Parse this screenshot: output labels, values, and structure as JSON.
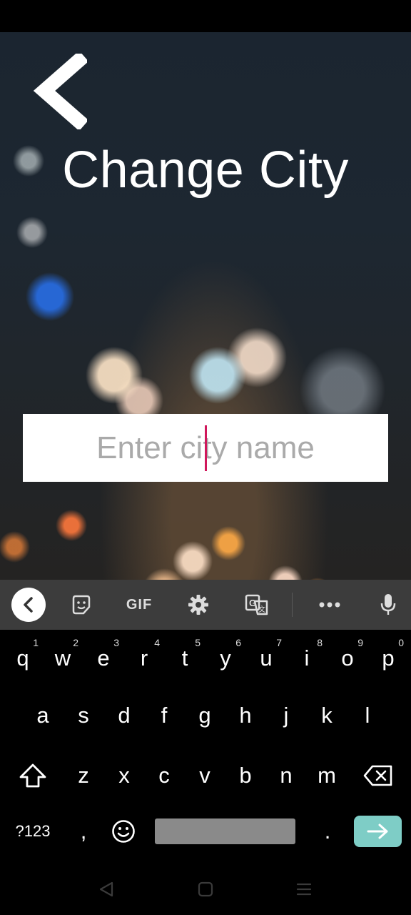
{
  "app": {
    "title": "Change City",
    "city_input": {
      "value": "",
      "placeholder": "Enter city name"
    }
  },
  "keyboard": {
    "toolbar": [
      "collapse-icon",
      "sticker-icon",
      "GIF",
      "gear-icon",
      "translate-icon",
      "more-icon",
      "mic-icon"
    ],
    "row1": [
      {
        "key": "q",
        "hint": "1"
      },
      {
        "key": "w",
        "hint": "2"
      },
      {
        "key": "e",
        "hint": "3"
      },
      {
        "key": "r",
        "hint": "4"
      },
      {
        "key": "t",
        "hint": "5"
      },
      {
        "key": "y",
        "hint": "6"
      },
      {
        "key": "u",
        "hint": "7"
      },
      {
        "key": "i",
        "hint": "8"
      },
      {
        "key": "o",
        "hint": "9"
      },
      {
        "key": "p",
        "hint": "0"
      }
    ],
    "row2": [
      "a",
      "s",
      "d",
      "f",
      "g",
      "h",
      "j",
      "k",
      "l"
    ],
    "row3": [
      "z",
      "x",
      "c",
      "v",
      "b",
      "n",
      "m"
    ],
    "symbols_label": "?123",
    "comma": ",",
    "period": ".",
    "accent_color": "#7ecdc6"
  },
  "navigation": [
    "back-icon",
    "home-icon",
    "recents-icon"
  ]
}
